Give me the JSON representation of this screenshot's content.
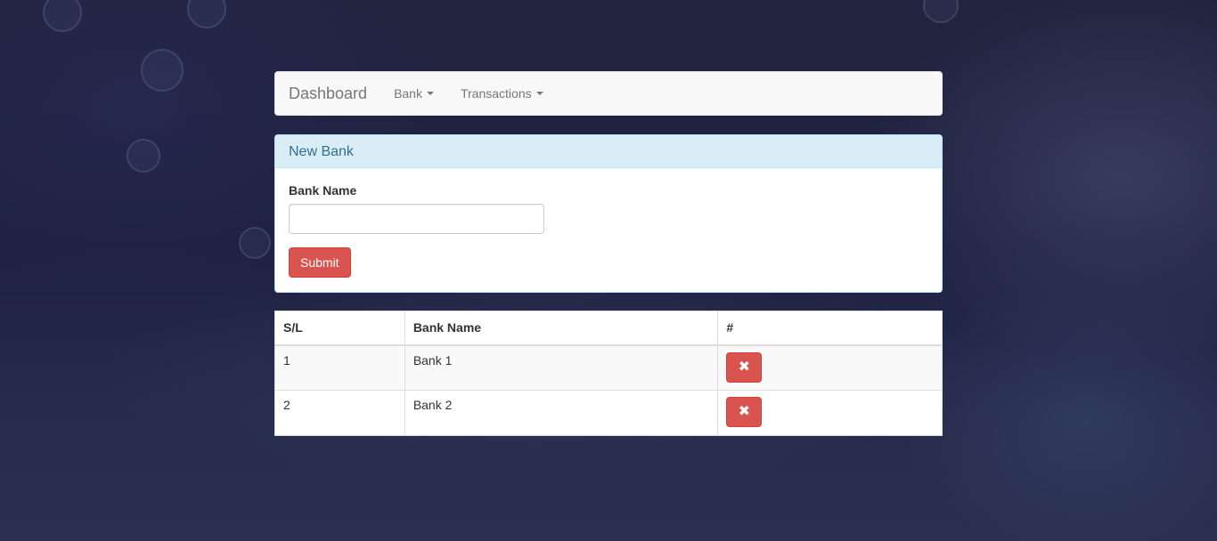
{
  "navbar": {
    "brand": "Dashboard",
    "items": [
      {
        "label": "Bank"
      },
      {
        "label": "Transactions"
      }
    ]
  },
  "panel": {
    "heading": "New Bank",
    "field_label": "Bank Name",
    "field_value": "",
    "field_placeholder": "",
    "submit_label": "Submit"
  },
  "table": {
    "headers": [
      "S/L",
      "Bank Name",
      "#"
    ],
    "rows": [
      {
        "sl": "1",
        "name": "Bank 1",
        "action_icon": "close-icon"
      },
      {
        "sl": "2",
        "name": "Bank 2",
        "action_icon": "close-icon"
      }
    ]
  },
  "colors": {
    "danger": "#d9534f",
    "info_heading_bg": "#d9edf7",
    "info_heading_text": "#31708f",
    "navbar_bg": "#f8f8f8"
  }
}
